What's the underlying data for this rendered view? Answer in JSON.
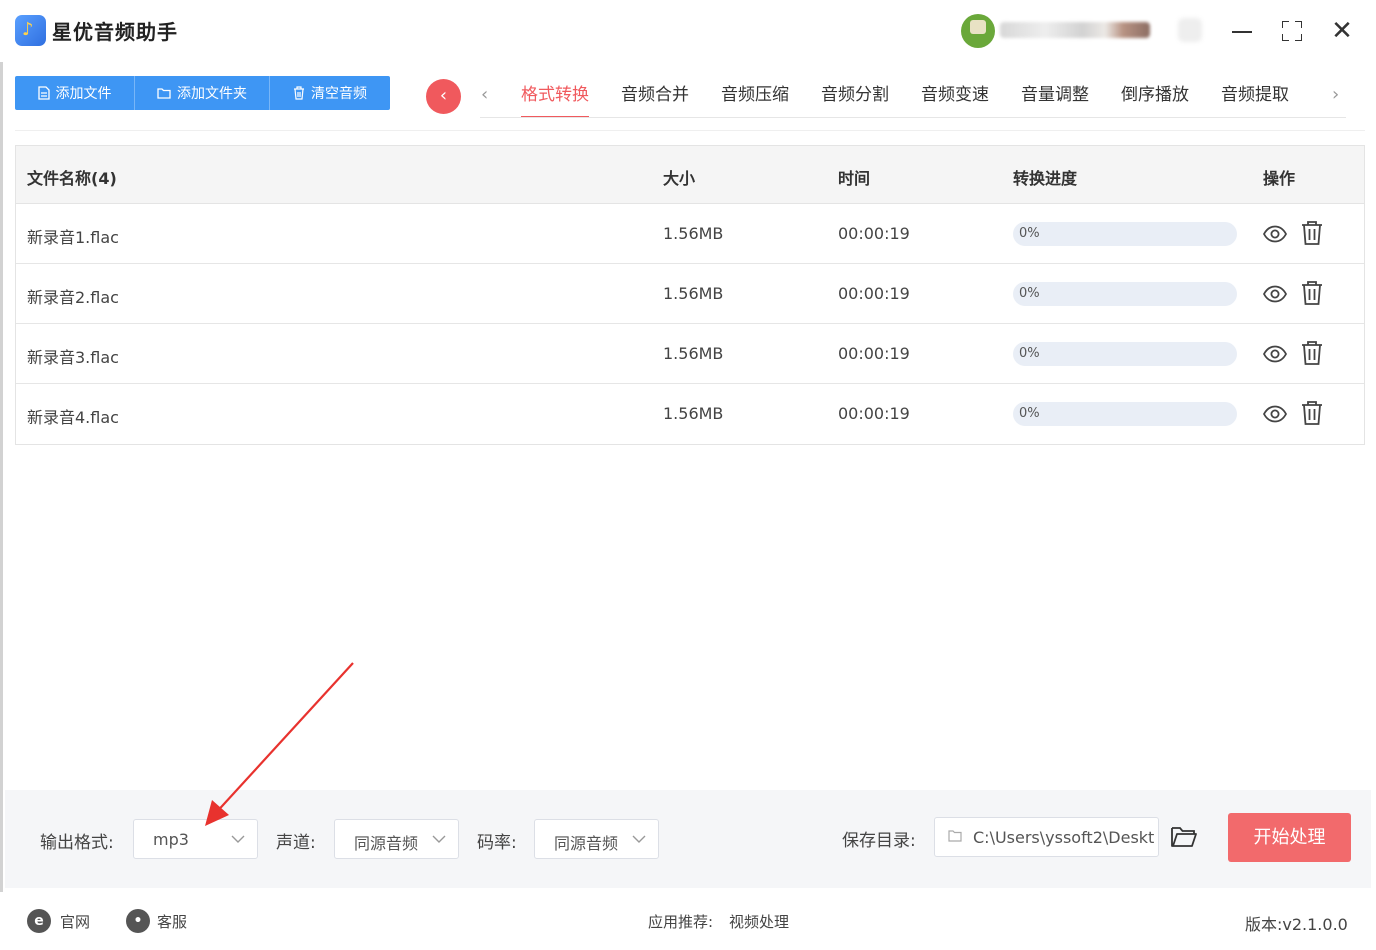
{
  "app": {
    "title": "星优音频助手"
  },
  "toolbar": {
    "add_file": "添加文件",
    "add_folder": "添加文件夹",
    "clear_audio": "清空音频"
  },
  "tabs": [
    {
      "label": "格式转换",
      "active": true
    },
    {
      "label": "音频合并"
    },
    {
      "label": "音频压缩"
    },
    {
      "label": "音频分割"
    },
    {
      "label": "音频变速"
    },
    {
      "label": "音量调整"
    },
    {
      "label": "倒序播放"
    },
    {
      "label": "音频提取"
    }
  ],
  "table": {
    "headers": {
      "name": "文件名称(4)",
      "size": "大小",
      "time": "时间",
      "progress": "转换进度",
      "action": "操作"
    },
    "rows": [
      {
        "name": "新录音1.flac",
        "size": "1.56MB",
        "time": "00:00:19",
        "progress": "0%",
        "progress_value": 0
      },
      {
        "name": "新录音2.flac",
        "size": "1.56MB",
        "time": "00:00:19",
        "progress": "0%",
        "progress_value": 0
      },
      {
        "name": "新录音3.flac",
        "size": "1.56MB",
        "time": "00:00:19",
        "progress": "0%",
        "progress_value": 0
      },
      {
        "name": "新录音4.flac",
        "size": "1.56MB",
        "time": "00:00:19",
        "progress": "0%",
        "progress_value": 0
      }
    ]
  },
  "settings": {
    "format_label": "输出格式:",
    "format_value": "mp3",
    "channel_label": "声道:",
    "channel_value": "同源音频",
    "bitrate_label": "码率:",
    "bitrate_value": "同源音频",
    "save_label": "保存目录:",
    "save_path": "C:\\Users\\yssoft2\\Deskt",
    "start_button": "开始处理"
  },
  "footer": {
    "website": "官网",
    "support": "客服",
    "recommend_label": "应用推荐:",
    "recommend_value": "视频处理",
    "version": "版本:v2.1.0.0"
  },
  "colors": {
    "primary_blue": "#3e96f4",
    "accent_red": "#f05a5e",
    "start_button": "#f26a6c",
    "annotation_arrow": "#e8322e"
  },
  "icons": [
    "music-note-icon",
    "file-icon",
    "folder-icon",
    "trash-icon",
    "chevron-left-icon",
    "chevron-right-icon",
    "eye-icon",
    "folder-open-icon",
    "ie-icon",
    "chat-icon",
    "minimize-icon",
    "maximize-icon",
    "close-icon"
  ]
}
